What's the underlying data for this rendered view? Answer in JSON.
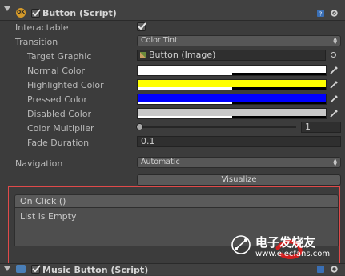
{
  "component": {
    "title": "Button (Script)",
    "enabled": true,
    "icon_name": "ok-gear-icon"
  },
  "properties": {
    "interactable_label": "Interactable",
    "interactable_checked": true,
    "transition_label": "Transition",
    "transition_value": "Color Tint",
    "target_graphic_label": "Target Graphic",
    "target_graphic_value": "Button (Image)",
    "normal_color_label": "Normal Color",
    "highlighted_color_label": "Highlighted Color",
    "pressed_color_label": "Pressed Color",
    "disabled_color_label": "Disabled Color",
    "color_multiplier_label": "Color Multiplier",
    "color_multiplier_value": "1",
    "fade_duration_label": "Fade Duration",
    "fade_duration_value": "0.1",
    "navigation_label": "Navigation",
    "navigation_value": "Automatic",
    "visualize_label": "Visualize"
  },
  "colors": {
    "normal": "#ffffff",
    "highlighted": "#ffff00",
    "pressed": "#0000ff",
    "disabled": "#c8c8c8",
    "highlight_box": "#e04a4a"
  },
  "on_click": {
    "title": "On Click ()",
    "empty_text": "List is Empty"
  },
  "next_component": {
    "title": "Music Button (Script)"
  },
  "watermark": {
    "text": "电子发烧友",
    "url": "www.elecfans.com"
  }
}
